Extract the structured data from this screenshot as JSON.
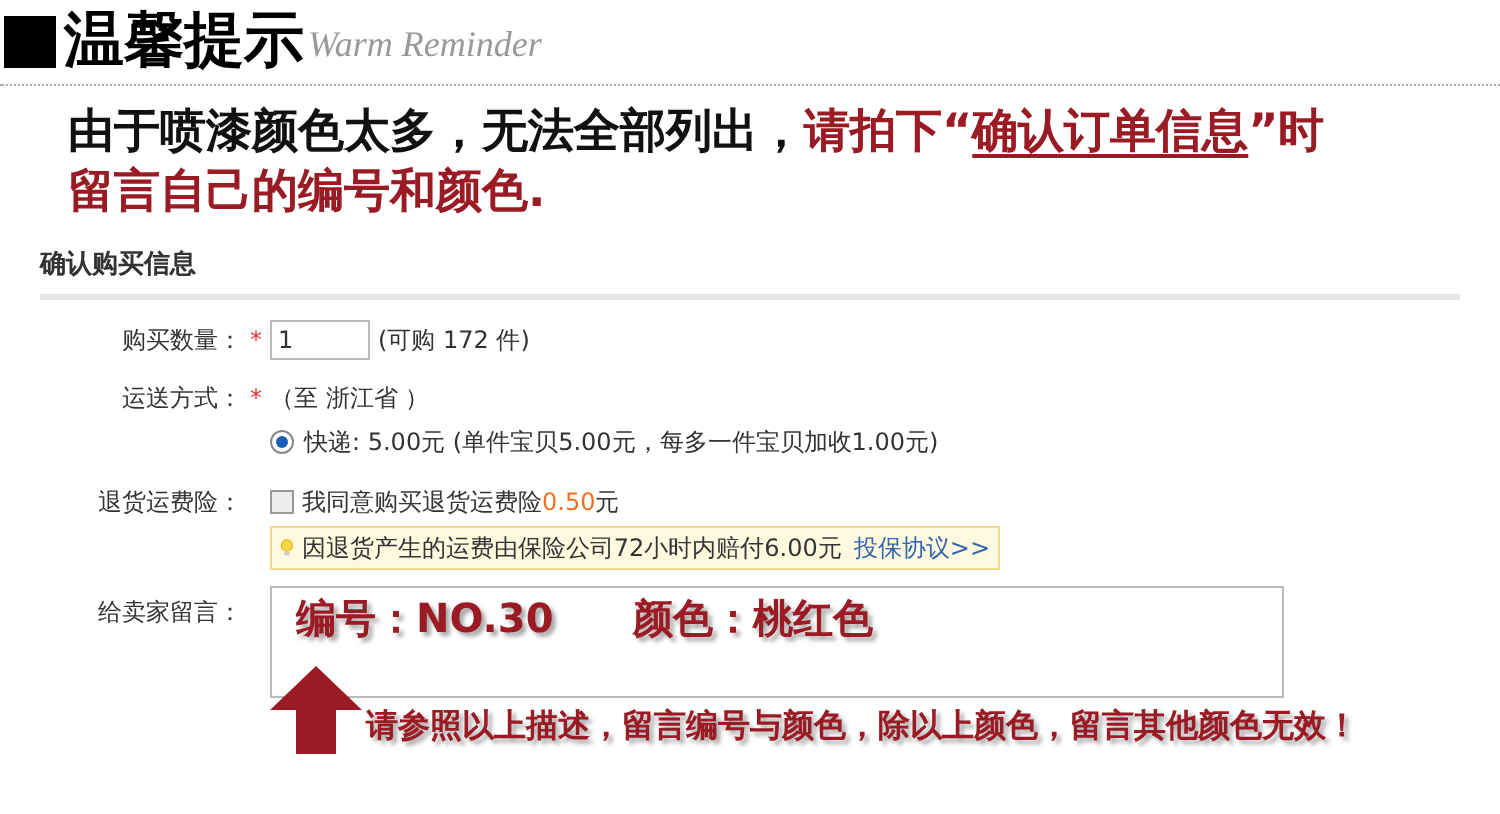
{
  "header": {
    "title": "温馨提示",
    "subtitle": "Warm Reminder"
  },
  "notice": {
    "lines": [
      [
        {
          "text": "由于喷漆颜色太多，无法全部列出，",
          "kind": "plain"
        },
        {
          "text": "请拍下“",
          "kind": "highlight"
        },
        {
          "text": "确认订单信息",
          "kind": "underlined"
        },
        {
          "text": "”时",
          "kind": "highlight"
        }
      ],
      [
        {
          "text": "留言自己的编号和颜色.",
          "kind": "highlight"
        }
      ]
    ]
  },
  "form": {
    "title": "确认购买信息",
    "quantity": {
      "label": "购买数量：",
      "required_mark": "*",
      "value": "1",
      "note": "(可购 172 件)"
    },
    "shipping": {
      "label": "运送方式：",
      "required_mark": "*",
      "destination": "（至 浙江省 ）",
      "options": [
        {
          "label": "快递: 5.00元 (单件宝贝5.00元，每多一件宝贝加收1.00元)",
          "selected": true
        }
      ]
    },
    "insurance": {
      "label": "退货运费险：",
      "checked": false,
      "text": "我同意购买退货运费险",
      "price": "0.50",
      "unit": "元",
      "tip": "因退货产生的运费由保险公司72小时内赔付6.00元",
      "tip_link": "投保协议>>"
    },
    "message": {
      "label": "给卖家留言：",
      "value": "编号：NO.30　　颜色：桃红色"
    }
  },
  "instruction": "请参照以上描述，留言编号与颜色，除以上颜色，留言其他颜色无效！"
}
